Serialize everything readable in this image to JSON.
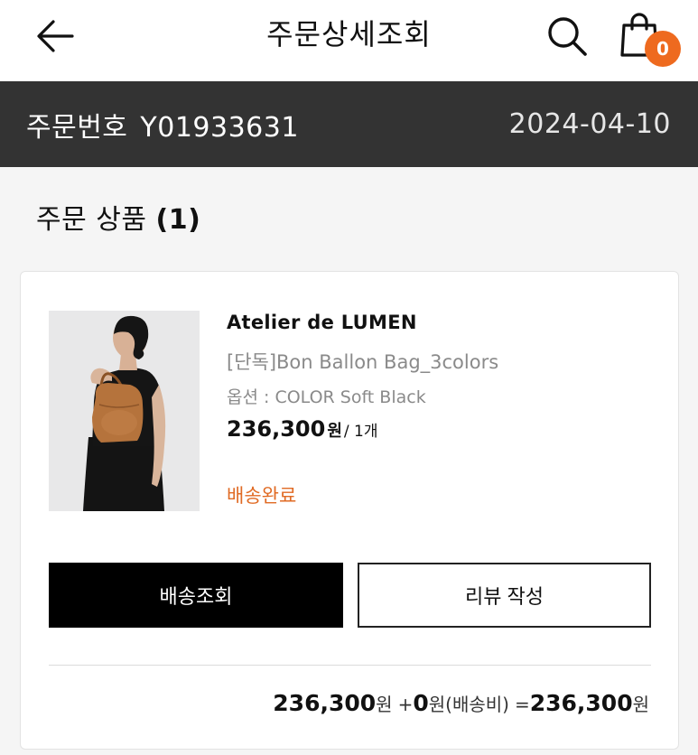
{
  "header": {
    "title": "주문상세조회",
    "cart_count": "0"
  },
  "order": {
    "number_label": "주문번호",
    "number": "Y01933631",
    "date": "2024-04-10"
  },
  "section": {
    "title": "주문 상품",
    "count": "(1)"
  },
  "product": {
    "brand": "Atelier de LUMEN",
    "name": "[단독]Bon Ballon Bag_3colors",
    "option": "옵션 : COLOR Soft Black",
    "price": "236,300",
    "price_unit": "원",
    "quantity": "/ 1개",
    "status": "배송완료",
    "status_color": "#e06a23"
  },
  "actions": {
    "track_label": "배송조회",
    "review_label": "리뷰 작성"
  },
  "summary": {
    "product_total": "236,300",
    "plus": "+",
    "shipping_fee": "0",
    "shipping_note": "(배송비)",
    "equals": "=",
    "grand_total": "236,300",
    "unit": "원"
  },
  "icons": {
    "back": "back-arrow-icon",
    "search": "search-icon",
    "cart": "shopping-bag-icon"
  },
  "colors": {
    "accent": "#ee6a1f",
    "order_bar": "#333333"
  }
}
